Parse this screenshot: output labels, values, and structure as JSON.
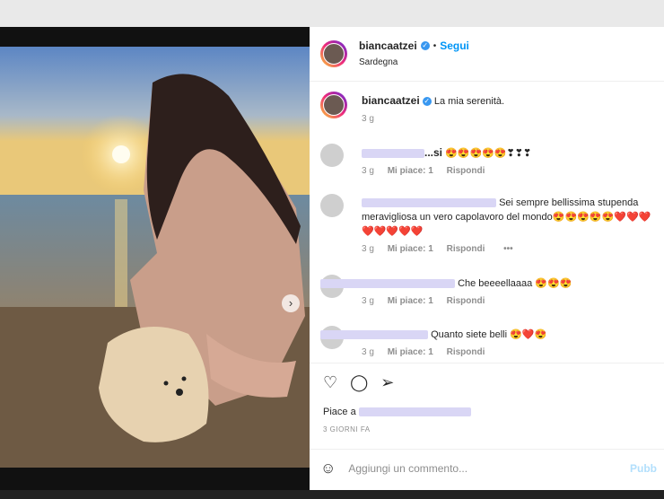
{
  "post": {
    "username": "biancaatzei",
    "follow_label": "Segui",
    "separator": "•",
    "location": "Sardegna",
    "caption": "La mia serenità.",
    "caption_time": "3 g",
    "like_prefix": "Piace a",
    "date": "3 GIORNI FA",
    "add_comment_placeholder": "Aggiungi un commento...",
    "publish_label": "Pubb",
    "next_label": "›"
  },
  "comments": [
    {
      "user": "...si",
      "text": "😍😍😍😍😍❣❣❣",
      "time": "3 g",
      "likes": "Mi piace: 1",
      "reply": "Rispondi"
    },
    {
      "user": "",
      "text": "Sei sempre bellissima stupenda meravigliosa un vero capolavoro del mondo😍😍😍😍😍❤️❤️❤️❤️❤️❤️❤️❤️",
      "time": "3 g",
      "likes": "Mi piace: 1",
      "reply": "Rispondi",
      "more": "•••"
    },
    {
      "user": "",
      "text": "Che beeeellaaaa 😍😍😍",
      "time": "3 g",
      "likes": "Mi piace: 1",
      "reply": "Rispondi"
    },
    {
      "user": "",
      "text": "Quanto siete belli 😍❤️😍",
      "time": "3 g",
      "likes": "Mi piace: 1",
      "reply": "Rispondi"
    }
  ],
  "icons": {
    "like": "heart-icon",
    "comment": "comment-icon",
    "share": "share-icon",
    "emoji": "emoji-icon",
    "verified": "verified-badge-icon"
  },
  "colors": {
    "accent": "#0095f6",
    "verified": "#3897f0",
    "publish_disabled": "#b2dffc"
  }
}
